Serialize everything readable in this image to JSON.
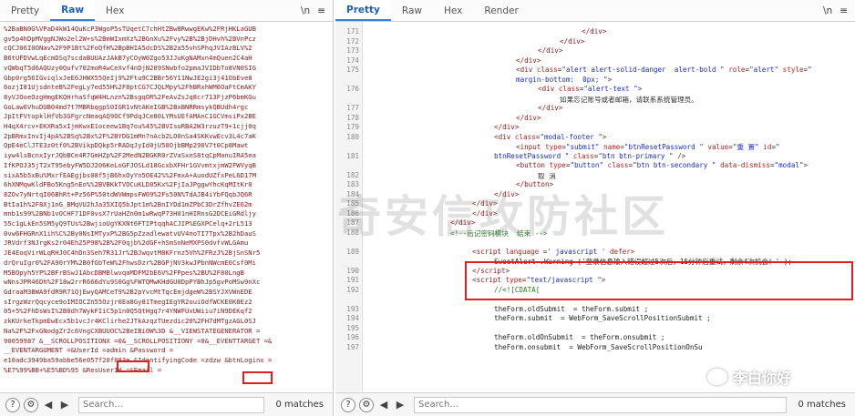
{
  "left_pane": {
    "tabs": [
      "Pretty",
      "Raw",
      "Hex"
    ],
    "active_tab": "Raw",
    "toolbar_icons": [
      "\\n",
      "≡"
    ],
    "raw_lines": [
      "%2BaBN0G%VPaD4kW14QuKcP3WgoP5sTUqetC7chHtZBw8RwwgEKw%2FRjHKLaGUB",
      "gv5p4hDpMVggNJWo2el2W+s%2BmWIxmXz%2BGnXu%2Fvy%2B%2BjDHvh%2BVnPcz",
      "cQCJ06I0ONav%2F9P1Bt%2FoQfH%2BpBHIA5dcDS%2B2a55vhSPhqJVIAzBLV%2",
      "B6tUFDVwLqEcmDSq7scdaBUUAzJAkB7yCOyW0Zgo53JJuKgNAMxn4mQuen2C4aH",
      "vQWbqT5d6AQUzy0Qufv702moR4wCeXvf4nDjN209SNwbfo2pmaJVIDbTo8VN0SIG",
      "Gbp0rg56IGviqlxJeE6JHWX55QeIj9%2Ftu9C2BBr56Y11NwJE2gi3j41ObEve8",
      "6ozjI81UjsdnteB%2FegLy7ed55H%2F8ptCG7CJQLMpy%2FhBRxhWM0OaFtCmAKY",
      "8yVJOoeOzgHmgEKQHrhaSfqW4HLnzn%2BsgqOR%2FeAvZsJq8cr713FjzP6bmKGu",
      "GoLaw6VhuDUB04md7t7MBRbqgpS0IGR1vNtAKeIGB%2BxBNRRmsykQBUdh4rgc",
      "JpItFVtopklHfVb3GFgrcNeaqAQ9OCf9PdqJCe80LYMsUEfAMAnC1GCVmsiPx2BE",
      "H4qX4rcv+EKXRa5xIjmKwxE1oceew1Bq7ou%45%2BVIsuRBA2W3rzuzT9+1cjj0q",
      "2pBRmxInvIj4pA%2BSq%2Bx%2F%2BYDG1mMn7nAcb2LO0nSa4SKKvwEcv3L4c7aK",
      "QpE4eClJTE3z0tf0%2BVikpDQkp5rRADqJyId0jU50OjbBMp290V7t0Cp8Mawt",
      "iyw4lsBcnxIyrJQbBCe4R7GmHZp%2F2MedN2BGKR0rZVaSxnS8tqCpManuIRA5ea",
      "IfKPOJ35jT2xT95ebyFW5DJ206KeLoGFJOSLd18GcxbXFHr1GVvmtxjmW2FWVyqB",
      "sixA5b5xBu%MxrfEAEgjbs08f5jB6hxOyYn5OE42%%2FmxA+AuodUZfxPeL6D17M",
      "6hXNMqwKldFBo5Kng5nEo%%2BVBKkTVOCuKLD05Kx%2FjIaJPggwYhcKqMItKr0",
      "8ZOv7yNrtqI06BhRt+Pz56P%50tdWVWmpsFW09%2Fs50N%TdAJB4iYbFQqbJQ6R",
      "BtIa1h%2F8Xj1nG_BMqVU2hJa35XIQ5bJpt1m%2BnIYDd1mZPbC3DrZfhvZE62m",
      "mnb1s99%2BNb1vOCHF71DF0vsX7rUaHZn0m1wRwqP73H01nHIRnsG2DCEiGRdljy",
      "55c1gLkEn5SM5yQ9TUs%2BwjioUgYKXNt6FTIPtqqhACJIP%EGXPCelq+2rL513",
      "0vw6FHGRnX1ih%C%2By0NsIMTyxP%2BG5pZzadlewatvUV4noTI7Tpx%2B2hDauS",
      "JRVdrf3NJrgKs2r04Eh25P98%2B%2F0qjb%2dGF+hSmSnNeMXPS0dvfvWLGAmu",
      "JE4EoqVirWLqRHJ0C4hDn3Seh7R31Jr%2BJwqvtM8KFrnz5Vh%2FRzJ%2BjSnSNr5",
      "drQruIgr0%2FA90rYM%2B0fGbTeW%2FhwsDzr%2BGPjNV3kwJPbnNWcmE0Csf0Mi",
      "M5BOpyh5YP%2BFrBSwJ1AbcDBMBlwvqaMDFM2bE6V%2FPpes%2BU%2F80LngB",
      "wNnsJPR46Dh%2F18w2rrR666dYu9S0Gg%FWTQMwKHdGU0DpPYBhJp5gvPoMSw9nXc",
      "GdraaM3BWA9fdR9R71QjEwyQAMCeT9%2B2pYvcMtTqcEmjdgeW%2BSYJXVWnEDE",
      "sIrgzWzrQqcyce9oIMIOCZn55Ozjr0Ea8Gy81TmegIEgYR2ouiOdfWCKE0K8Ez2",
      "05+5%2FhDsWsI%2B0dh7WykFIiC5p1n0Q5QtHgq7r4YNWFUxUWiiu7iN9DEKqf2",
      "zkKUrkeTkpmEwEcx5b1vcJr4KClirhe2JTkAzqzTUezdic20%2FH7dMTgzAGL0SJ",
      "Na%2F%2FxGNodgZr2c6VngCXBUUOC%2BeIBi0W%3D &__VIEWSTATEGENERATOR =",
      "90059987 &__SCROLLPOSITIONX =0&__SCROLLPOSITIONY =0&__EVENTTARGET =&",
      "__EVENTARGUMENT =&UserId =admin &Password =",
      "e10adc3949ba59abbe56e057f20f883e &IdentifyingCode =zdzw &btnLoginx =",
      "%E7%99%BB+%E5%BD%95 &ResUserId =&Email ="
    ],
    "highlight_userid": "admin",
    "highlight_code": "zdzw",
    "search_placeholder": "Search...",
    "matches": "0 matches"
  },
  "right_pane": {
    "tabs": [
      "Pretty",
      "Raw",
      "Hex",
      "Render"
    ],
    "active_tab": "Pretty",
    "toolbar_icons": [
      "\\n",
      "≡"
    ],
    "lines": [
      {
        "n": "171",
        "html": "<span class='tag'>&lt;/div&gt;</span>",
        "indent": 20
      },
      {
        "n": "172",
        "html": "<span class='tag'>&lt;/div&gt;</span>",
        "indent": 16
      },
      {
        "n": "173",
        "html": "<span class='tag'>&lt;/div&gt;</span>",
        "indent": 12
      },
      {
        "n": "174",
        "html": "<span class='tag'>&lt;/div&gt;</span>",
        "indent": 8
      },
      {
        "n": "175",
        "html": "<span class='tag'>&lt;div</span> <span class='attr'>class</span>=<span class='val'>\"alert alert-solid-danger  alert-bold \"</span> <span class='attr'>role</span>=<span class='val'>\"alert\"</span> <span class='attr'>style</span>=<span class='val'>\"</span>",
        "indent": 8
      },
      {
        "n": "",
        "html": "<span class='val'>margin-bottom:  0px; \"</span><span class='tag'>&gt;</span>",
        "indent": 8
      },
      {
        "n": "176",
        "html": "<span class='tag'>&lt;div</span> <span class='attr'>class</span>=<span class='val'>\"alert-text \"</span><span class='tag'>&gt;</span>",
        "indent": 12
      },
      {
        "n": "",
        "html": "<span class='txt'>如果忘记账号或者邮箱，请联系系统管理员。</span>",
        "indent": 16
      },
      {
        "n": "177",
        "html": "<span class='tag'>&lt;/div&gt;</span>",
        "indent": 12
      },
      {
        "n": "178",
        "html": "<span class='tag'>&lt;/div&gt;</span>",
        "indent": 8
      },
      {
        "n": "179",
        "html": "<span class='tag'>&lt;/div&gt;</span>",
        "indent": 4
      },
      {
        "n": "180",
        "html": "<span class='tag'>&lt;div</span> <span class='attr'>class</span>=<span class='val'>\"modal-footer \"</span><span class='tag'>&gt;</span>",
        "indent": 4
      },
      {
        "n": "",
        "html": "<span class='tag'>&lt;input</span> <span class='attr'>type</span>=<span class='val'>\"submit\"</span> <span class='attr'>name</span>=<span class='val'>\"btnResetPassword \"</span> <span class='attr'>value</span>=<span class='val'>\"重 置\"</span> <span class='attr'>id</span>=<span class='val'>\"</span>",
        "indent": 8
      },
      {
        "n": "181",
        "html": "<span class='val'>btnResetPassword \"</span> <span class='attr'>class</span>=<span class='val'>\"btn btn-primary \"</span> <span class='tag'>/&gt;</span>",
        "indent": 4
      },
      {
        "n": "",
        "html": "<span class='tag'>&lt;button</span> <span class='attr'>type</span>=<span class='val'>\"button\"</span> <span class='attr'>class</span>=<span class='val'>\"btn btn-secondary \"</span> <span class='attr'>data-dismiss</span>=<span class='val'>\"modal\"</span><span class='tag'>&gt;</span>",
        "indent": 8
      },
      {
        "n": "182",
        "html": "<span class='txt'>取 消</span>",
        "indent": 12
      },
      {
        "n": "183",
        "html": "<span class='tag'>&lt;/button&gt;</span>",
        "indent": 8
      },
      {
        "n": "184",
        "html": "<span class='tag'>&lt;/div&gt;</span>",
        "indent": 4
      },
      {
        "n": "185",
        "html": "<span class='tag'>&lt;/div&gt;</span>",
        "indent": 0
      },
      {
        "n": "186",
        "html": "<span class='tag'>&lt;/div&gt;</span>",
        "indent": 0
      },
      {
        "n": "187",
        "html": "<span class='tag'>&lt;/div&gt;</span>",
        "indent": -4
      },
      {
        "n": "188",
        "html": "<span class='cmt'>&lt;!--后记密码模块  结束 --&gt;</span>",
        "indent": -4
      },
      {
        "n": "",
        "html": "",
        "indent": 0
      },
      {
        "n": "189",
        "html": "<span class='tag'>&lt;script</span> <span class='attr'>language</span> =<span class='val'>' javascript '</span> <span class='attr'>defer</span><span class='tag'>&gt;</span>",
        "indent": 0
      },
      {
        "n": "",
        "html": "<span class='js'>SweetAlert .Warning ('登录信息输入错误超过5次后，15分钟后重试，剩余4次机会！' );</span>",
        "indent": 4
      },
      {
        "n": "190",
        "html": "<span class='tag'>&lt;/script&gt;</span>",
        "indent": 0
      },
      {
        "n": "191",
        "html": "<span class='tag'>&lt;script</span> <span class='attr'>type</span>=<span class='val'>\"text/javascript \"</span><span class='tag'>&gt;</span>",
        "indent": 0
      },
      {
        "n": "192",
        "html": "<span class='cmt'>//&lt;![CDATA[</span>",
        "indent": 4
      },
      {
        "n": "",
        "html": "",
        "indent": 0
      },
      {
        "n": "193",
        "html": "<span class='js'>theForm.oldSubmit  = theForm.submit ;</span>",
        "indent": 4
      },
      {
        "n": "194",
        "html": "<span class='js'>theForm.submit  = WebForm_SaveScrollPositionSubmit ;</span>",
        "indent": 4
      },
      {
        "n": "195",
        "html": "",
        "indent": 0
      },
      {
        "n": "196",
        "html": "<span class='js'>theForm.oldOnSubmit  = theForm.onsubmit ;</span>",
        "indent": 4
      },
      {
        "n": "197",
        "html": "<span class='js'>theForm.onsubmit  = WebForm_SaveScrollPositionOnSu</span>",
        "indent": 4
      }
    ],
    "search_placeholder": "Search...",
    "matches": "0 matches"
  },
  "watermark": "奇安信攻防社区",
  "wechat_label": "李白你好"
}
